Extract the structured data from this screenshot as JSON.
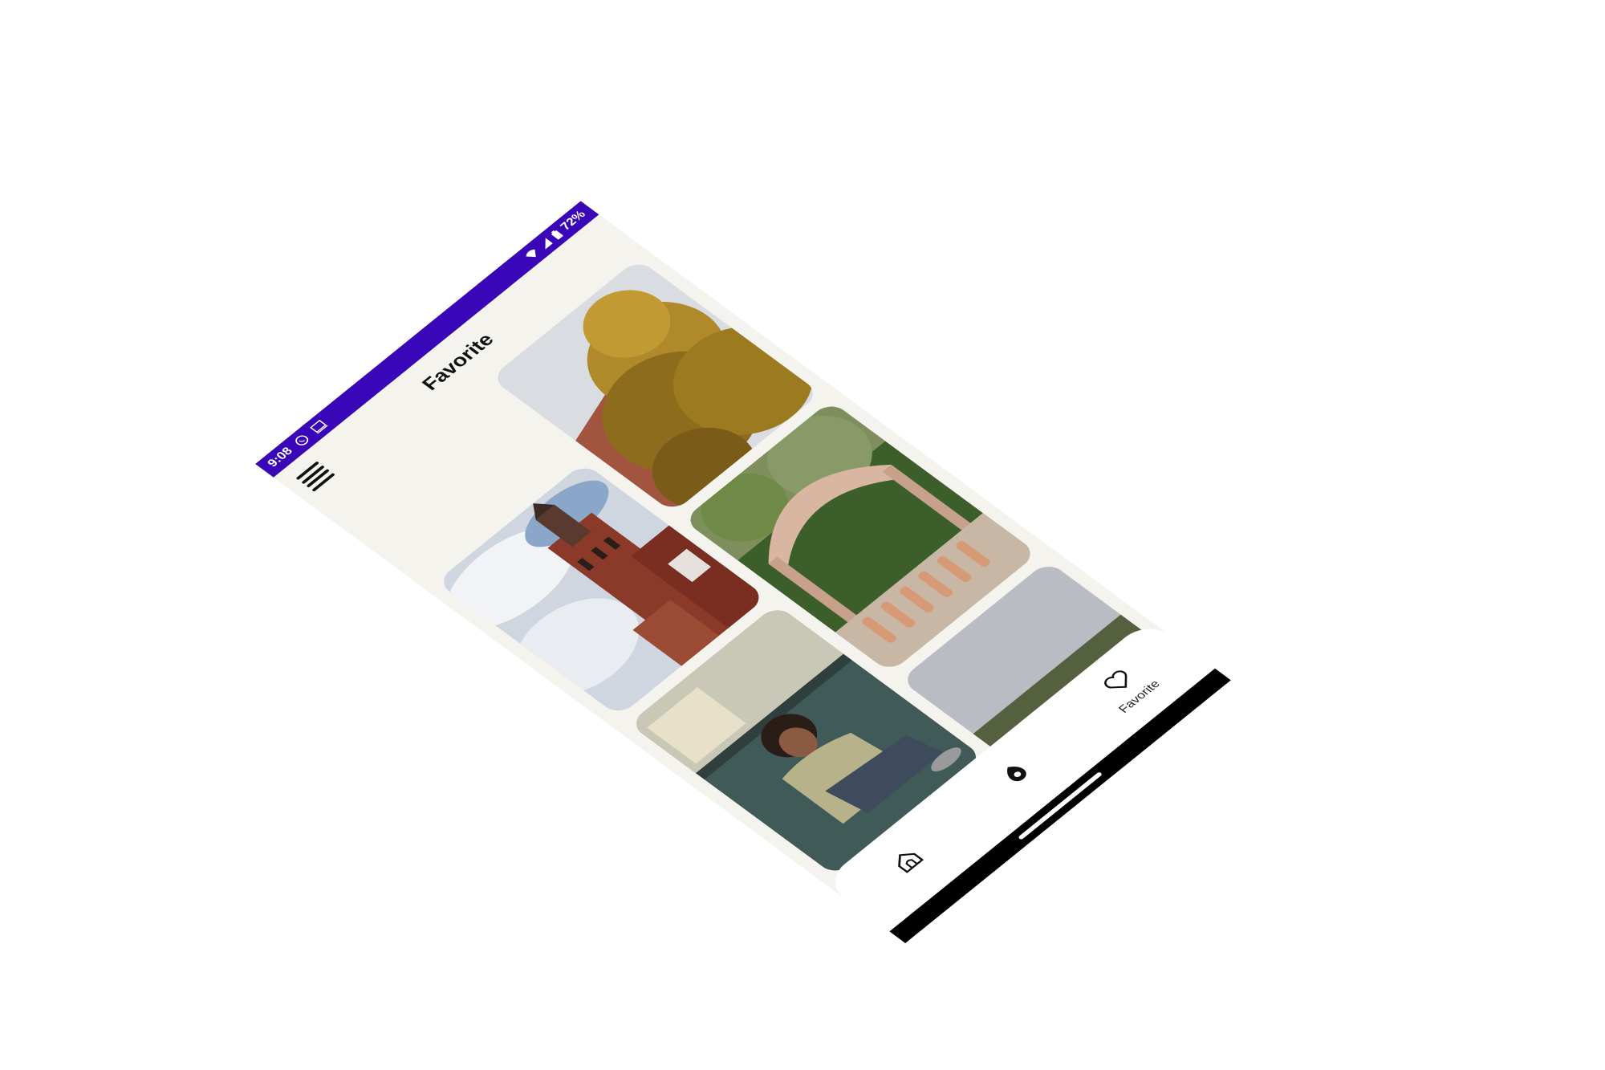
{
  "status_bar": {
    "time": "9:08",
    "battery": "72%",
    "background": "#3a07b8",
    "icons_left": [
      "whatsapp-icon",
      "screen-icon"
    ],
    "icons_right": [
      "wifi-icon",
      "signal-icon",
      "battery-icon"
    ]
  },
  "app_bar": {
    "title": "Favorite",
    "menu_icon": "hamburger-icon"
  },
  "gallery": {
    "items": [
      {
        "subject": "castle-tower"
      },
      {
        "subject": "autumn-tree-rooftop"
      },
      {
        "subject": "man-sitting-train"
      },
      {
        "subject": "ivy-arch-balustrade"
      },
      {
        "subject": "partial-image"
      }
    ]
  },
  "bottom_nav": {
    "items": [
      {
        "icon": "home-icon",
        "label": ""
      },
      {
        "icon": "explore-icon",
        "label": ""
      },
      {
        "icon": "heart-icon",
        "label": "Favorite"
      }
    ]
  },
  "colors": {
    "screen_bg": "#f4f3ee",
    "accent": "#3a07b8"
  }
}
